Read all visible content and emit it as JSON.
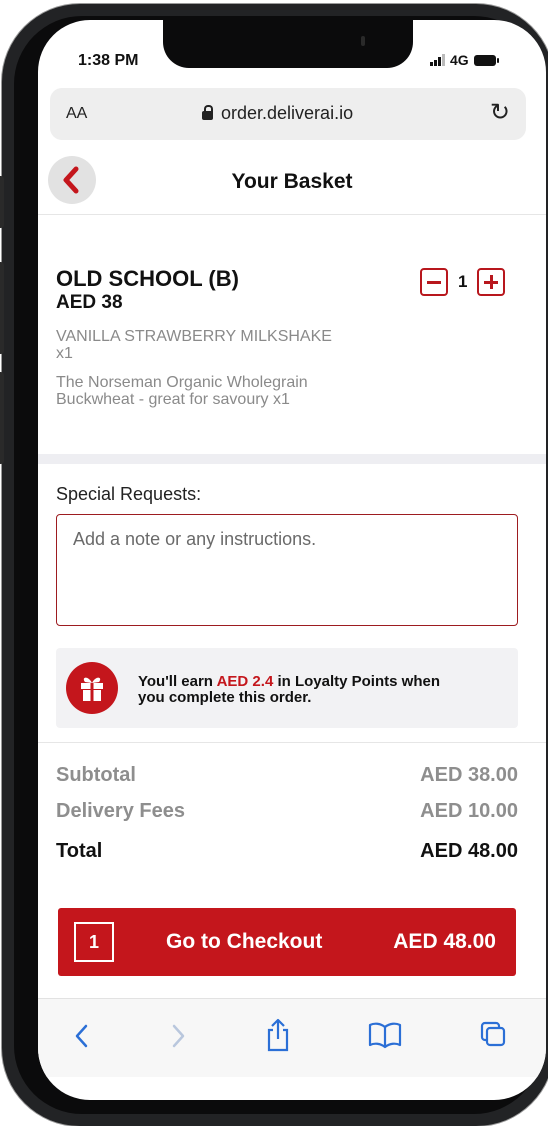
{
  "status_bar": {
    "time": "1:38 PM",
    "network": "4G"
  },
  "browser": {
    "text_size_label": "AA",
    "url": "order.deliverai.io"
  },
  "header": {
    "title": "Your Basket"
  },
  "basket_item": {
    "name": "OLD SCHOOL (B)",
    "price": "AED 38",
    "options": [
      [
        "VANILLA STRAWBERRY MILKSHAKE",
        "x1"
      ],
      [
        "The Norseman Organic Wholegrain",
        "Buckwheat - great for savoury x1"
      ]
    ],
    "quantity": "1"
  },
  "special_requests": {
    "label": "Special Requests:",
    "placeholder": "Add a note or any instructions."
  },
  "loyalty": {
    "prefix": "You'll earn ",
    "amount": "AED 2.4",
    "suffix_line1": " in Loyalty Points when",
    "line2": "you complete this order."
  },
  "totals": {
    "subtotal_label": "Subtotal",
    "subtotal_value": "AED 38.00",
    "delivery_label": "Delivery Fees",
    "delivery_value": "AED 10.00",
    "total_label": "Total",
    "total_value": "AED 48.00"
  },
  "checkout": {
    "count": "1",
    "label": "Go to Checkout",
    "amount": "AED 48.00"
  },
  "colors": {
    "accent": "#c4161c",
    "muted": "#8e8e8e"
  }
}
